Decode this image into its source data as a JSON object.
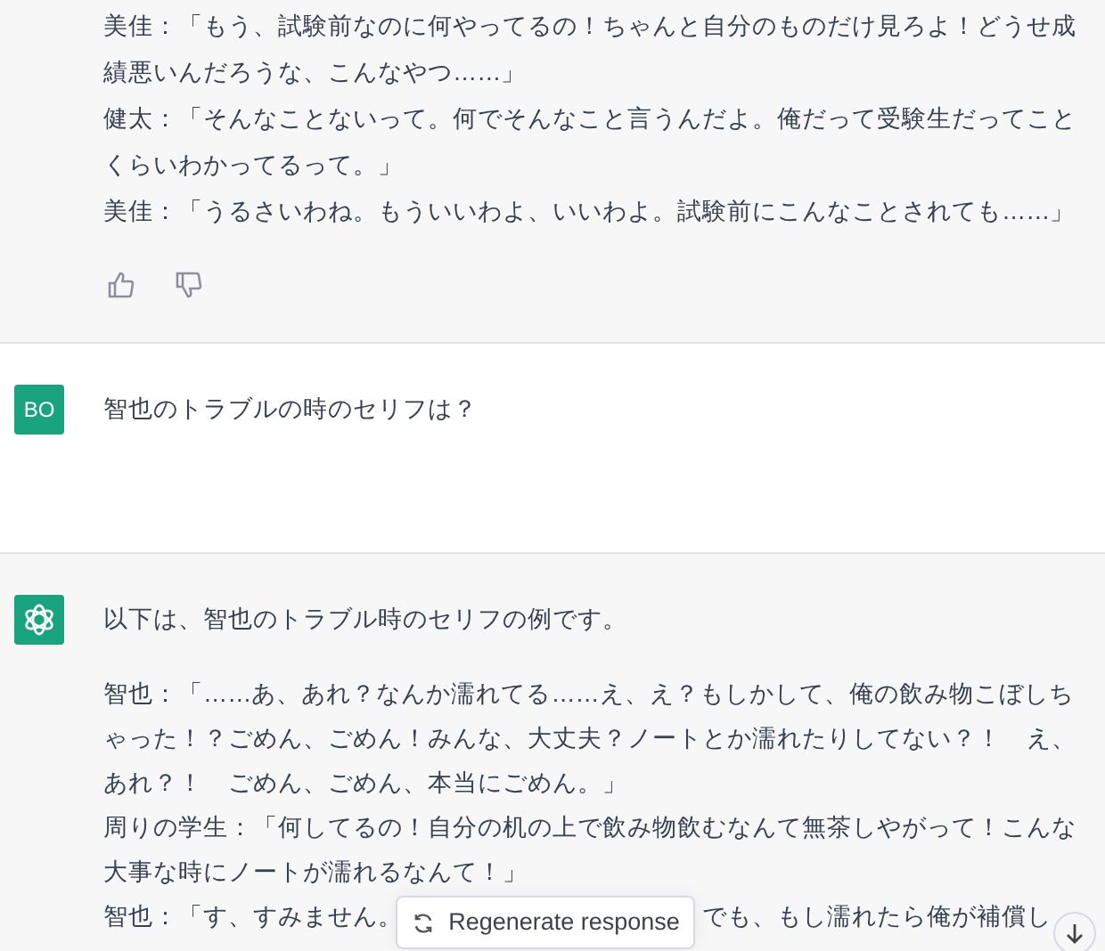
{
  "previous_response": {
    "lines": [
      "美佳：「もう、試験前なのに何やってるの！ちゃんと自分のものだけ見ろよ！どうせ成績悪いんだろうな、こんなやつ……」",
      "健太：「そんなことないって。何でそんなこと言うんだよ。俺だって受験生だってことくらいわかってるって。」",
      "美佳：「うるさいわね。もういいわよ、いいわよ。試験前にこんなことされても……」"
    ]
  },
  "user_message": {
    "avatar": "BO",
    "text": "智也のトラブルの時のセリフは？"
  },
  "assistant_message": {
    "intro": "以下は、智也のトラブル時のセリフの例です。",
    "lines": [
      "智也：「……あ、あれ？なんか濡れてる……え、え？もしかして、俺の飲み物こぼしちゃった！？ごめん、ごめん！みんな、大丈夫？ノートとか濡れたりしてない？！　え、あれ？！　ごめん、ごめん、本当にごめん。」",
      "周りの学生：「何してるの！自分の机の上で飲み物飲むなんて無茶しやがって！こんな大事な時にノートが濡れるなんて！」"
    ],
    "last_line": [
      "智也：「す、すみません。",
      "でも、もし濡れたら俺が補償し"
    ]
  },
  "regenerate_button": "Regenerate response"
}
